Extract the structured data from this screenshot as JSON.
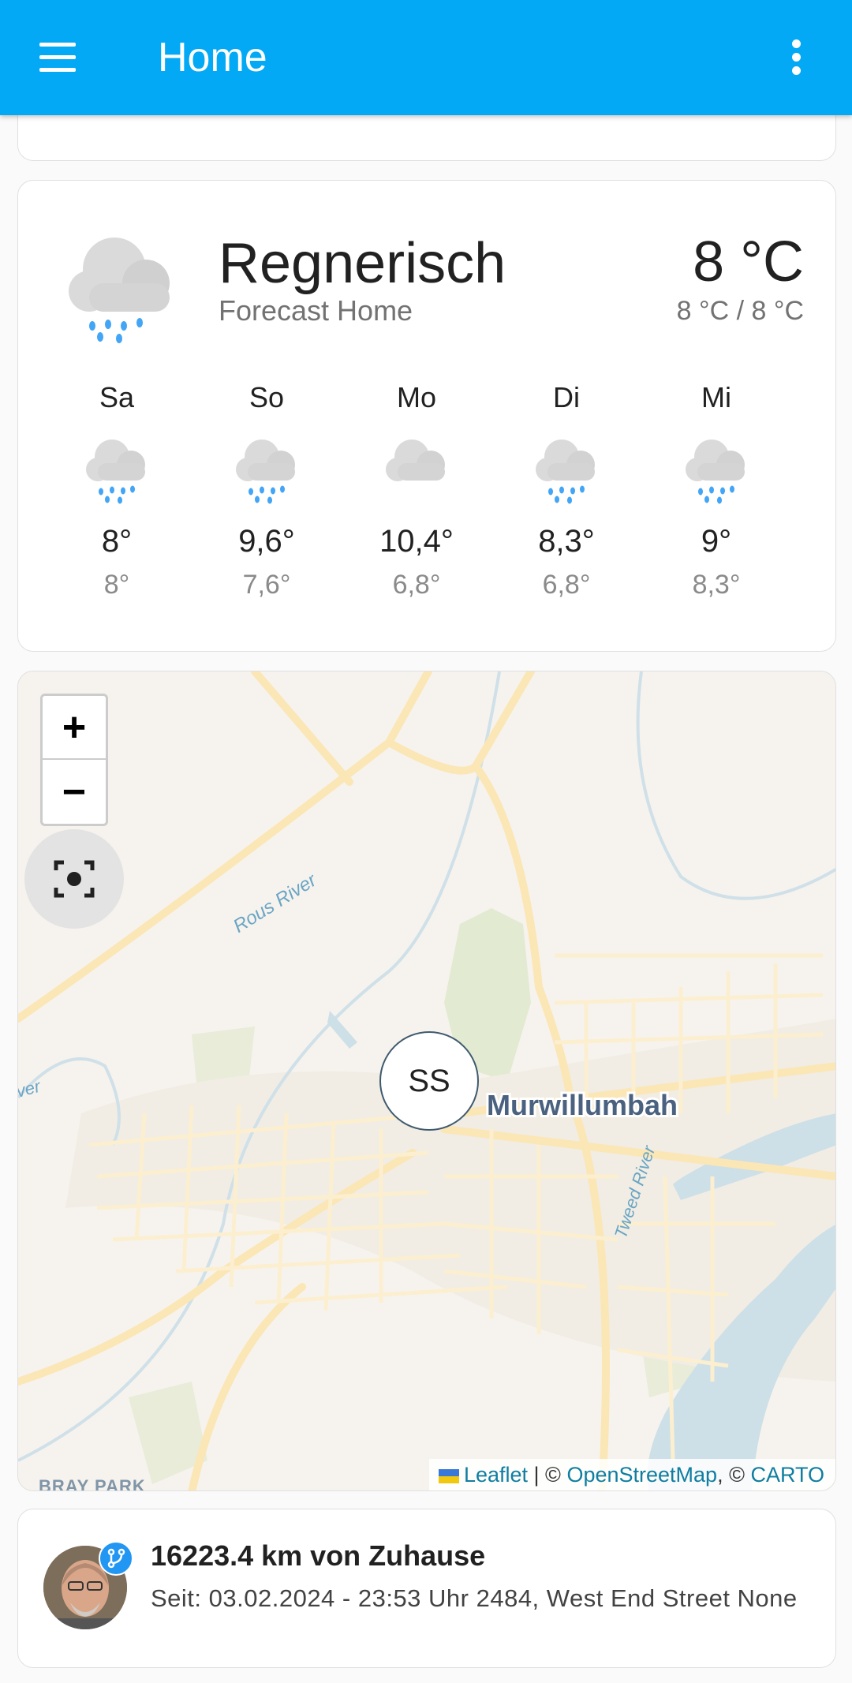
{
  "appbar": {
    "title": "Home"
  },
  "weather": {
    "condition": "Regnerisch",
    "entity_name": "Forecast Home",
    "temperature": "8 °C",
    "range": "8 °C / 8 °C",
    "icon": "rainy-icon",
    "days": [
      {
        "name": "Sa",
        "high": "8°",
        "low": "8°",
        "icon": "rainy-icon"
      },
      {
        "name": "So",
        "high": "9,6°",
        "low": "7,6°",
        "icon": "rainy-icon"
      },
      {
        "name": "Mo",
        "high": "10,4°",
        "low": "6,8°",
        "icon": "cloudy-icon"
      },
      {
        "name": "Di",
        "high": "8,3°",
        "low": "6,8°",
        "icon": "rainy-icon"
      },
      {
        "name": "Mi",
        "high": "9°",
        "low": "8,3°",
        "icon": "rainy-icon"
      }
    ]
  },
  "map": {
    "zoom_in": "+",
    "zoom_out": "−",
    "marker_label": "SS",
    "city_label": "Murwillumbah",
    "river_label_1": "Rous River",
    "river_label_2": "Tweed River",
    "river_label_3": "ver",
    "suburb_label": "BRAY PARK",
    "attribution": {
      "leaflet": "Leaflet",
      "sep1": " | © ",
      "osm": "OpenStreetMap",
      "sep2": ", © ",
      "carto": "CARTO"
    }
  },
  "person": {
    "title": "16223.4 km von Zuhause",
    "subtitle": "Seit: 03.02.2024 - 23:53 Uhr 2484, West End Street None"
  }
}
